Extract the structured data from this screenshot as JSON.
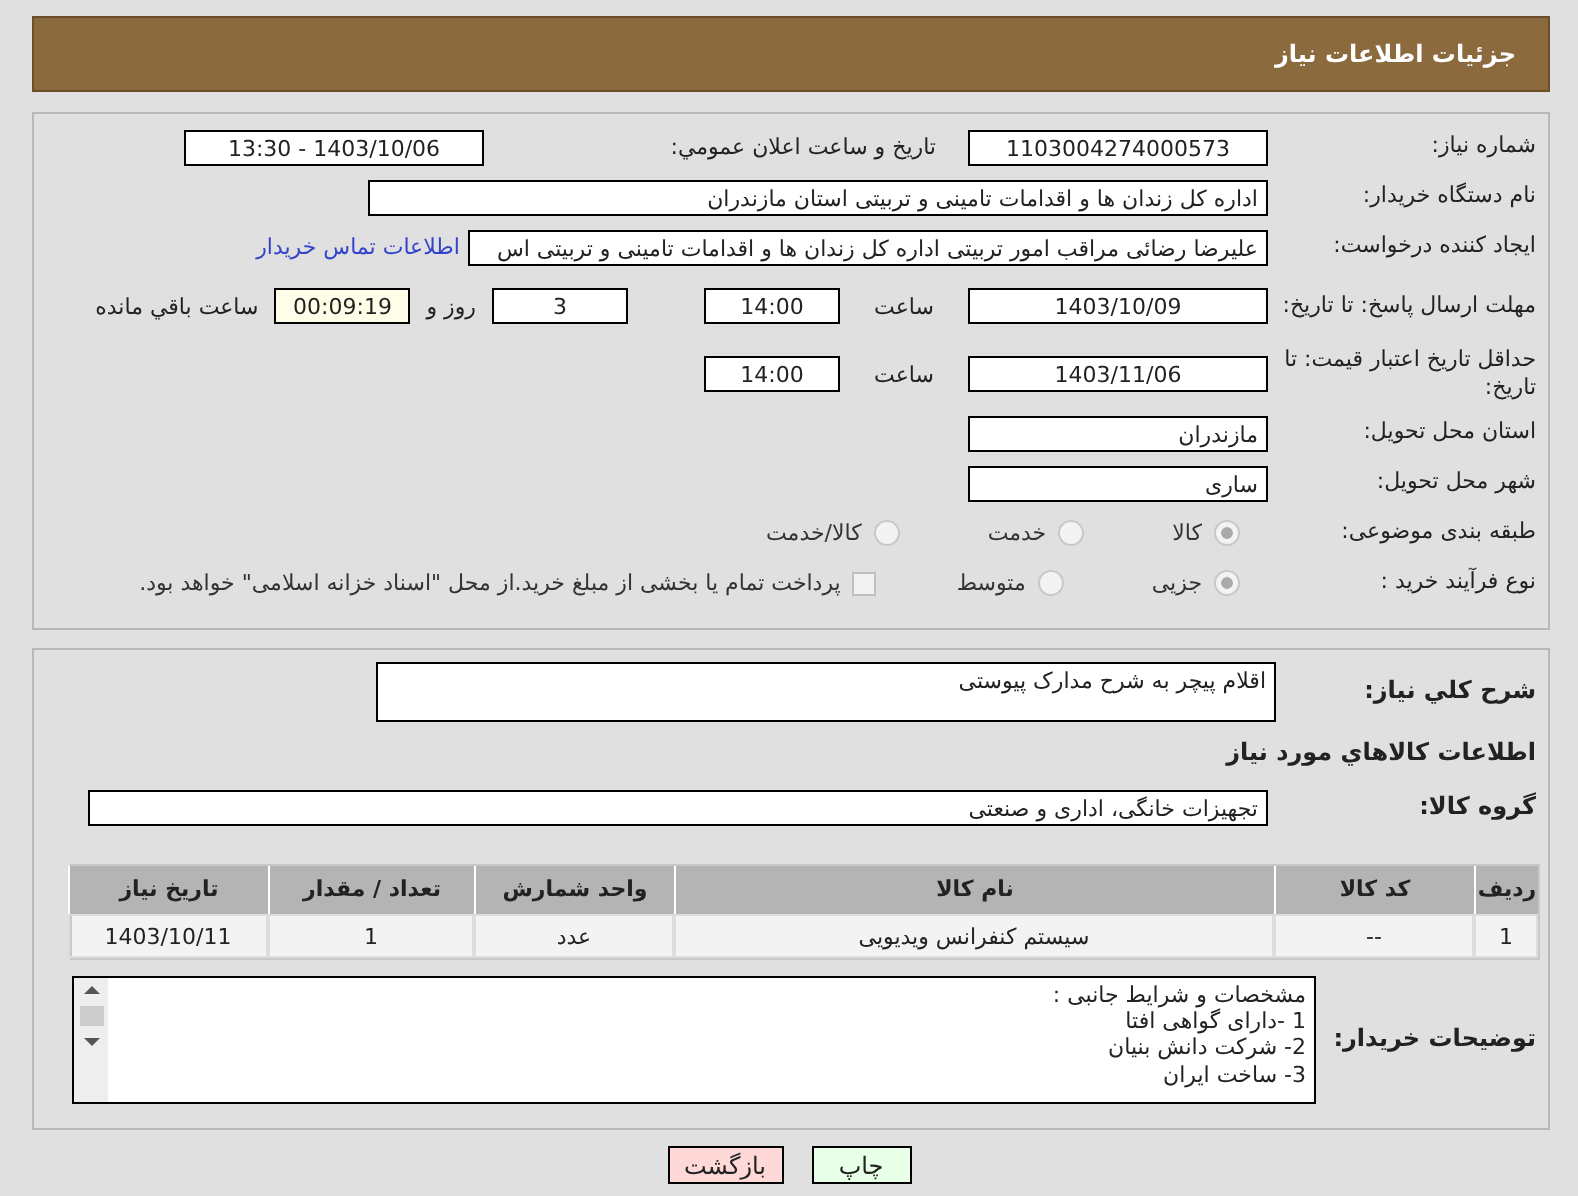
{
  "header": {
    "title": "جزئیات اطلاعات نیاز"
  },
  "need_number": {
    "label": "شماره نیاز:",
    "value": "1103004274000573"
  },
  "announce": {
    "label": "تاریخ و ساعت اعلان عمومي:",
    "value": "1403/10/06 - 13:30"
  },
  "buyer_org": {
    "label": "نام دستگاه خریدار:",
    "value": "اداره کل زندان ها و اقدامات تامینی و تربیتی استان مازندران"
  },
  "requester": {
    "label": "ایجاد کننده درخواست:",
    "value": "علیرضا رضائی مراقب امور تربیتی اداره کل زندان ها و اقدامات تامینی و تربیتی اس",
    "link": "اطلاعات تماس خریدار"
  },
  "deadline": {
    "label": "مهلت ارسال پاسخ: تا تاریخ:",
    "date": "1403/10/09",
    "time_label": "ساعت",
    "time": "14:00",
    "days": "3",
    "days_label": "روز و",
    "remaining": "00:09:19",
    "remaining_label": "ساعت باقي مانده"
  },
  "price_validity": {
    "label": "حداقل تاریخ اعتبار قیمت: تا تاریخ:",
    "date": "1403/11/06",
    "time_label": "ساعت",
    "time": "14:00"
  },
  "province": {
    "label": "استان محل تحویل:",
    "value": "مازندران"
  },
  "city": {
    "label": "شهر محل تحویل:",
    "value": "ساری"
  },
  "subject_category": {
    "label": "طبقه بندی موضوعی:",
    "options": [
      {
        "label": "کالا",
        "selected": true
      },
      {
        "label": "خدمت",
        "selected": false
      },
      {
        "label": "کالا/خدمت",
        "selected": false
      }
    ]
  },
  "purchase_type": {
    "label": "نوع فرآیند خرید :",
    "options": [
      {
        "label": "جزیی",
        "selected": true
      },
      {
        "label": "متوسط",
        "selected": false
      }
    ],
    "treasury": {
      "label": "پرداخت تمام یا بخشی از مبلغ خرید.از محل \"اسناد خزانه اسلامی\" خواهد بود.",
      "checked": false
    }
  },
  "description": {
    "label": "شرح کلي نیاز:",
    "value": "اقلام پیچر به شرح مدارک پیوستی"
  },
  "goods_heading": "اطلاعات کالاهاي مورد نیاز",
  "goods_group": {
    "label": "گروه کالا:",
    "value": "تجهیزات خانگی، اداری و صنعتی"
  },
  "table": {
    "columns": [
      "ردیف",
      "کد کالا",
      "نام کالا",
      "واحد شمارش",
      "تعداد / مقدار",
      "تاریخ نیاز"
    ],
    "rows": [
      [
        "1",
        "--",
        "سیستم کنفرانس ویدیویی",
        "عدد",
        "1",
        "1403/10/11"
      ]
    ]
  },
  "buyer_notes": {
    "label": "توضیحات خریدار:",
    "value": "مشخصات و شرایط جانبی :\n1 -دارای گواهی افتا\n2- شرکت دانش بنیان\n3- ساخت ایران"
  },
  "buttons": [
    {
      "label": "چاپ",
      "kind": "print"
    },
    {
      "label": "بازگشت",
      "kind": "back"
    }
  ]
}
